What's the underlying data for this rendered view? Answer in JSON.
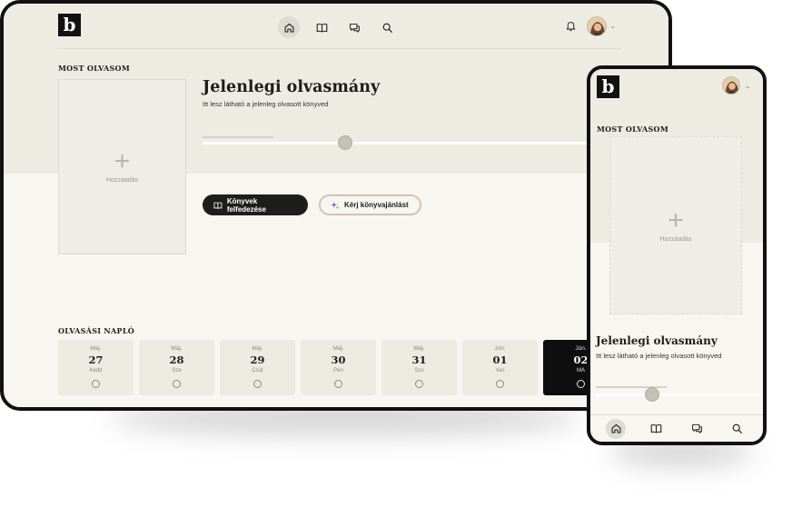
{
  "app": {
    "logo_letter": "b",
    "nav_icons": [
      "home-icon",
      "book-icon",
      "chat-icon",
      "search-icon"
    ],
    "active_nav": "home-icon",
    "notification_icon": "bell-icon"
  },
  "now_reading": {
    "label": "MOST OLVASOM",
    "add_label": "Hozzáadás",
    "title": "Jelenlegi olvasmány",
    "subtitle": "Itt lesz látható a jelenleg olvasott könyved"
  },
  "actions": {
    "discover_label": "Könyvek felfedezése",
    "recommend_label": "Kérj könyvajánlást"
  },
  "reading_log": {
    "label": "OLVASÁSI NAPLÓ",
    "days": [
      {
        "month": "Máj.",
        "day": "27",
        "weekday": "Kedd"
      },
      {
        "month": "Máj.",
        "day": "28",
        "weekday": "Sze"
      },
      {
        "month": "Máj.",
        "day": "29",
        "weekday": "Csüt"
      },
      {
        "month": "Máj.",
        "day": "30",
        "weekday": "Pén"
      },
      {
        "month": "Máj.",
        "day": "31",
        "weekday": "Szo"
      },
      {
        "month": "Jún.",
        "day": "01",
        "weekday": "Vas"
      },
      {
        "month": "Jún.",
        "day": "02",
        "weekday": "MA"
      }
    ]
  },
  "colors": {
    "background": "#f7f6f0",
    "band": "#edece3",
    "dark": "#1d1d1b",
    "today_tile": "#0e0e0e"
  }
}
